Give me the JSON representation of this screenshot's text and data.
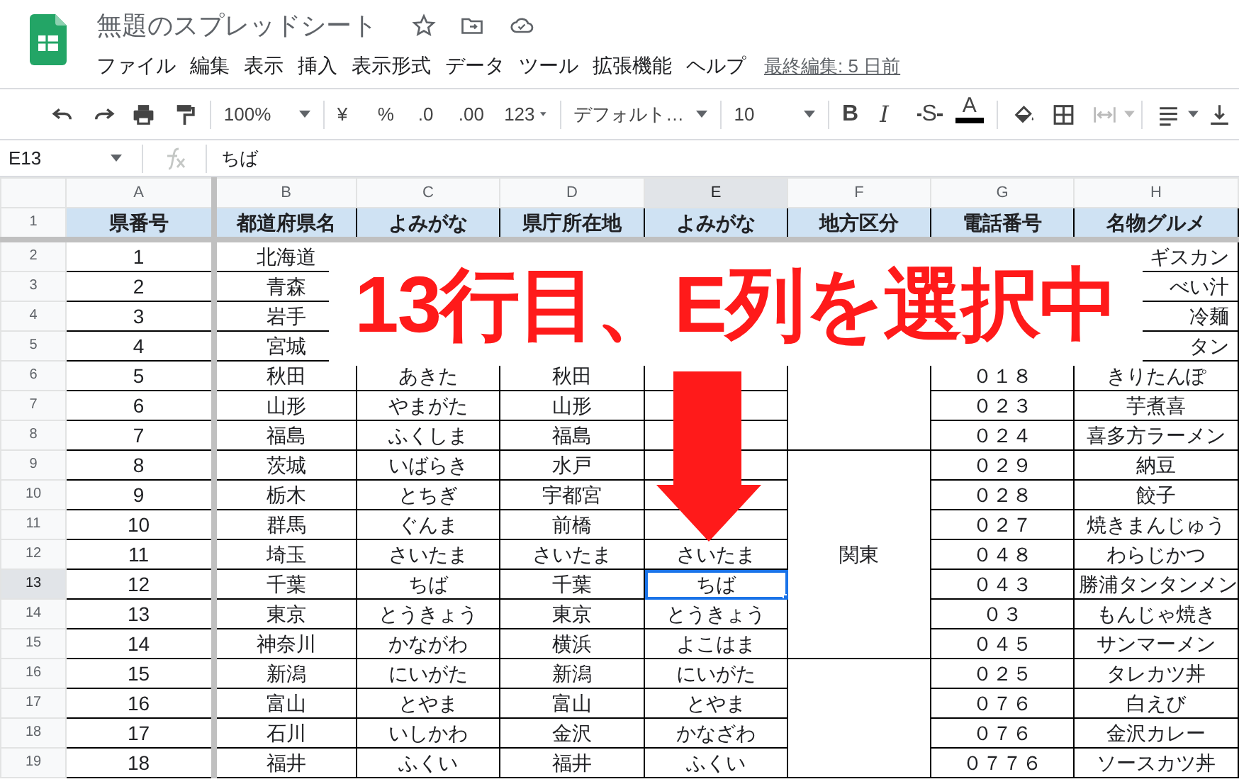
{
  "document": {
    "title": "無題のスプレッドシート"
  },
  "menu": [
    "ファイル",
    "編集",
    "表示",
    "挿入",
    "表示形式",
    "データ",
    "ツール",
    "拡張機能",
    "ヘルプ"
  ],
  "last_edit": "最終編集: 5 日前",
  "toolbar": {
    "zoom": "100%",
    "currency": "¥",
    "percent": "%",
    "decimal_decrease": ".0",
    "decimal_increase": ".00",
    "number_format": "123",
    "font": "デフォルト…",
    "font_size": "10",
    "bold": "B",
    "italic": "I",
    "strike": "S",
    "text_color": "A"
  },
  "formula_bar": {
    "cell_ref": "E13",
    "value": "ちば"
  },
  "sheet": {
    "columns": [
      {
        "label": "A",
        "selected": false
      },
      {
        "label": "B",
        "selected": false
      },
      {
        "label": "C",
        "selected": false
      },
      {
        "label": "D",
        "selected": false
      },
      {
        "label": "E",
        "selected": true
      },
      {
        "label": "F",
        "selected": false
      },
      {
        "label": "G",
        "selected": false
      },
      {
        "label": "H",
        "selected": false
      }
    ],
    "rows": [
      {
        "number": "1",
        "kind": "header",
        "selected": false,
        "cells": [
          "県番号",
          "都道府県名",
          "よみがな",
          "県庁所在地",
          "よみがな",
          "地方区分",
          "電話番号",
          "名物グルメ"
        ]
      },
      {
        "number": "2",
        "kind": "data",
        "selected": false,
        "cells": [
          "1",
          "北海道",
          null,
          null,
          null,
          null,
          "ギスカン"
        ]
      },
      {
        "number": "3",
        "kind": "data",
        "selected": false,
        "cells": [
          "2",
          "青森",
          null,
          null,
          null,
          null,
          "べい汁"
        ]
      },
      {
        "number": "4",
        "kind": "data",
        "selected": false,
        "cells": [
          "3",
          "岩手",
          null,
          null,
          null,
          null,
          "冷麺"
        ]
      },
      {
        "number": "5",
        "kind": "data",
        "selected": false,
        "cells": [
          "4",
          "宮城",
          null,
          null,
          null,
          null,
          "タン"
        ]
      },
      {
        "number": "6",
        "kind": "data",
        "selected": false,
        "region_start": false,
        "cells": [
          "5",
          "秋田",
          "あきた",
          "秋田",
          null,
          "０１８",
          "きりたんぽ"
        ]
      },
      {
        "number": "7",
        "kind": "data",
        "selected": false,
        "region_start": false,
        "cells": [
          "6",
          "山形",
          "やまがた",
          "山形",
          null,
          "０２３",
          "芋煮喜"
        ]
      },
      {
        "number": "8",
        "kind": "data",
        "selected": false,
        "region_start": false,
        "cells": [
          "7",
          "福島",
          "ふくしま",
          "福島",
          null,
          "０２４",
          "喜多方ラーメン"
        ]
      },
      {
        "number": "9",
        "kind": "data",
        "selected": false,
        "region_start": true,
        "cells": [
          "8",
          "茨城",
          "いばらき",
          "水戸",
          null,
          "０２９",
          "納豆"
        ]
      },
      {
        "number": "10",
        "kind": "data",
        "selected": false,
        "region_start": false,
        "cells": [
          "9",
          "栃木",
          "とちぎ",
          "宇都宮",
          null,
          "０２８",
          "餃子"
        ]
      },
      {
        "number": "11",
        "kind": "data",
        "selected": false,
        "region_start": false,
        "cells": [
          "10",
          "群馬",
          "ぐんま",
          "前橋",
          null,
          "０２７",
          "焼きまんじゅう"
        ]
      },
      {
        "number": "12",
        "kind": "data",
        "selected": false,
        "region_start": false,
        "region": "関東",
        "cells": [
          "11",
          "埼玉",
          "さいたま",
          "さいたま",
          "さいたま",
          "０４８",
          "わらじかつ"
        ]
      },
      {
        "number": "13",
        "kind": "data",
        "selected": true,
        "region_start": false,
        "cells": [
          "12",
          "千葉",
          "ちば",
          "千葉",
          "ちば",
          "０４３",
          "勝浦タンタンメン"
        ]
      },
      {
        "number": "14",
        "kind": "data",
        "selected": false,
        "region_start": false,
        "cells": [
          "13",
          "東京",
          "とうきょう",
          "東京",
          "とうきょう",
          "０３",
          "もんじゃ焼き"
        ]
      },
      {
        "number": "15",
        "kind": "data",
        "selected": false,
        "region_start": false,
        "cells": [
          "14",
          "神奈川",
          "かながわ",
          "横浜",
          "よこはま",
          "０４５",
          "サンマーメン"
        ]
      },
      {
        "number": "16",
        "kind": "data",
        "selected": false,
        "region_start": true,
        "cells": [
          "15",
          "新潟",
          "にいがた",
          "新潟",
          "にいがた",
          "０２５",
          "タレカツ丼"
        ]
      },
      {
        "number": "17",
        "kind": "data",
        "selected": false,
        "region_start": false,
        "cells": [
          "16",
          "富山",
          "とやま",
          "富山",
          "とやま",
          "０７６",
          "白えび"
        ]
      },
      {
        "number": "18",
        "kind": "data",
        "selected": false,
        "region_start": false,
        "cells": [
          "17",
          "石川",
          "いしかわ",
          "金沢",
          "かなざわ",
          "０７６",
          "金沢カレー"
        ]
      },
      {
        "number": "19",
        "kind": "data",
        "selected": false,
        "region_start": false,
        "cells": [
          "18",
          "福井",
          "ふくい",
          "福井",
          "ふくい",
          "０７７６",
          "ソースカツ丼"
        ]
      }
    ]
  },
  "annotation": {
    "text": "13行目、E列を選択中"
  }
}
